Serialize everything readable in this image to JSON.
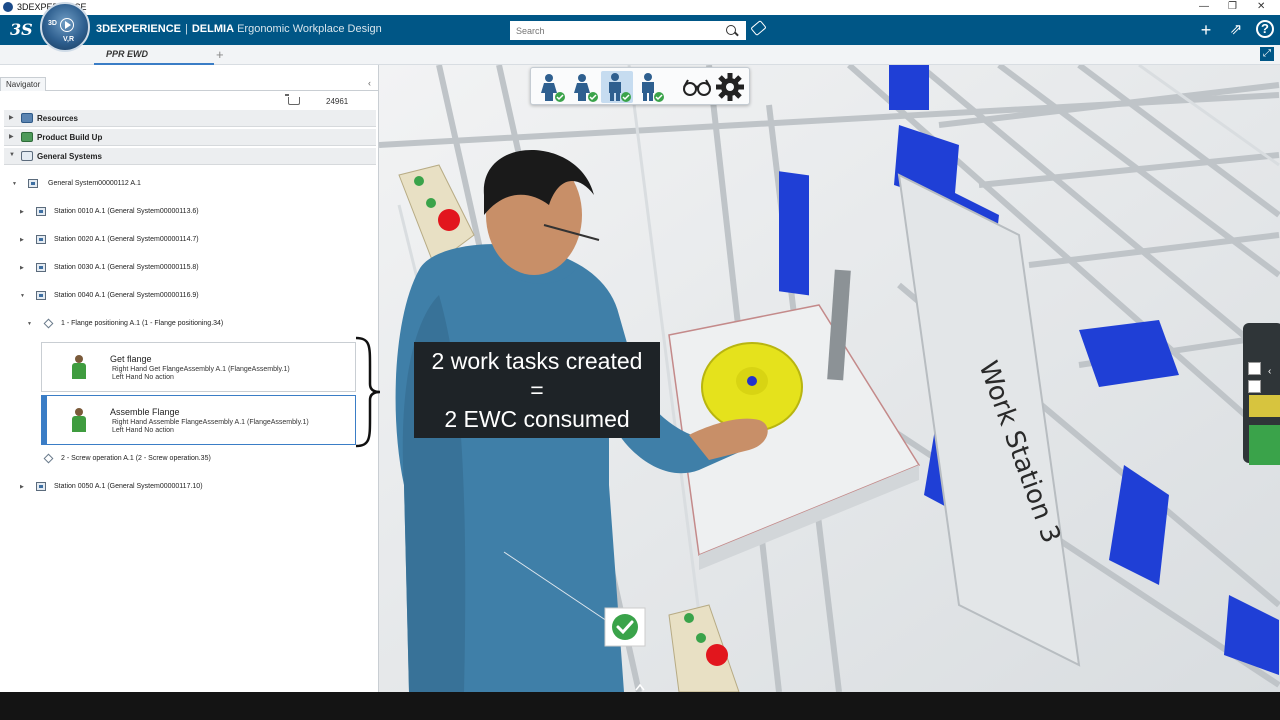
{
  "os": {
    "title": "3DEXPERIENCE",
    "minimize": "—",
    "restore": "❐",
    "close": "✕"
  },
  "header": {
    "logo": "3S",
    "compass_left": "3D",
    "compass_version": "V,R",
    "brand": "3DEXPERIENCE",
    "product": "DELMIA",
    "app": "Ergonomic Workplace Design",
    "search_placeholder": "Search",
    "add": "+",
    "share": "⇗",
    "help": "?"
  },
  "tabs": {
    "active": "PPR EWD",
    "add": "+",
    "expand": "⤢"
  },
  "navigator": {
    "tab": "Navigator",
    "collapse": "‹",
    "cart_count": "24961",
    "categories": [
      {
        "label": "Resources",
        "expanded": false
      },
      {
        "label": "Product Build Up",
        "expanded": false
      },
      {
        "label": "General Systems",
        "expanded": true
      }
    ],
    "tree": {
      "root": "General System00000112 A.1",
      "stations": [
        "Station 0010 A.1 (General System00000113.6)",
        "Station 0020 A.1 (General System00000114.7)",
        "Station 0030 A.1 (General System00000115.8)",
        "Station 0040 A.1 (General System00000116.9)"
      ],
      "operation1": "1 - Flange positioning A.1 (1 - Flange positioning.34)",
      "tasks": [
        {
          "title": "Get flange",
          "line1": "Right Hand Get FlangeAssembly A.1 (FlangeAssembly.1)",
          "line2": "Left Hand No action",
          "selected": false
        },
        {
          "title": "Assemble Flange",
          "line1": "Right Hand Assemble FlangeAssembly A.1 (FlangeAssembly.1)",
          "line2": "Left Hand No action",
          "selected": true
        }
      ],
      "operation2": "2 - Screw operation A.1 (2 - Screw operation.35)",
      "station5": "Station 0050 A.1 (General System00000117.10)"
    }
  },
  "viewport": {
    "annotation": {
      "line1": "2 work tasks created",
      "line2": "=",
      "line3": "2 EWC consumed"
    },
    "workstation_label": "Work Station 3",
    "colors": {
      "shirt": "#3f7fa8",
      "flange": "#e5e21c",
      "bins": "#1f3fd6",
      "frame": "#cfd3d6",
      "check": "#3aa34a"
    }
  }
}
